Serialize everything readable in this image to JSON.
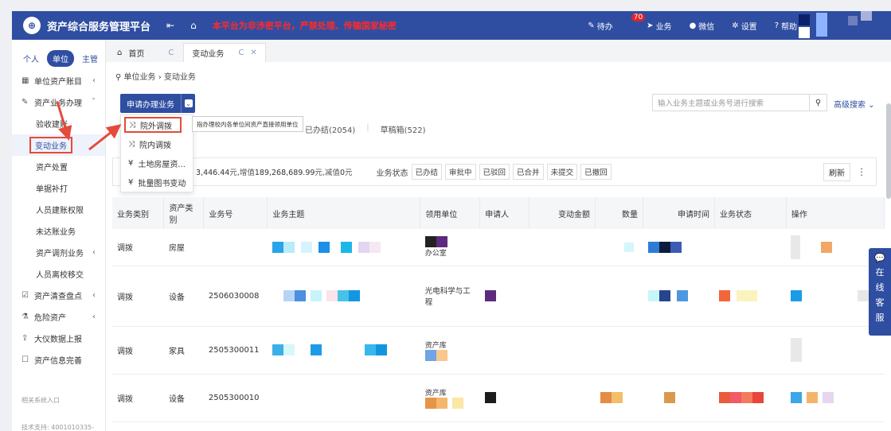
{
  "topbar": {
    "title": "资产综合服务管理平台",
    "notice": "本平台为非涉密平台，严禁处理、传输国家秘密",
    "todo_label": "待办",
    "todo_count": "70",
    "business_label": "业务",
    "wechat_label": "微信",
    "settings_label": "设置",
    "help_label": "帮助"
  },
  "sidebar": {
    "roles": [
      "个人",
      "单位",
      "主管"
    ],
    "items": [
      {
        "label": "单位资产账目",
        "icon": "grid-icon"
      },
      {
        "label": "资产业务办理",
        "icon": "pencil-icon"
      },
      {
        "label": "验收建账"
      },
      {
        "label": "变动业务"
      },
      {
        "label": "资产处置"
      },
      {
        "label": "单据补打"
      },
      {
        "label": "人员建账权限"
      },
      {
        "label": "未达账业务"
      },
      {
        "label": "资产调剂业务"
      },
      {
        "label": "人员离校移交"
      },
      {
        "label": "资产清查盘点",
        "icon": "check-icon"
      },
      {
        "label": "危险资产",
        "icon": "flask-icon"
      },
      {
        "label": "大仪数据上报",
        "icon": "upload-icon"
      },
      {
        "label": "资产信息完善",
        "icon": "edit-icon"
      }
    ],
    "footer1": "相关系统入口",
    "footer2": "技术支持: 4001010335-"
  },
  "tabs": [
    {
      "label": "首页"
    },
    {
      "label": "变动业务"
    }
  ],
  "breadcrumb": "单位业务 › 变动业务",
  "apply_button": "申请办理业务",
  "menu": [
    "院外调拨",
    "院内调拨",
    "土地房屋资...",
    "批量图书变动"
  ],
  "tooltip": "指办理校内各单位间资产直接领用单位",
  "filter_tabs": [
    "已办结(2054)",
    "草稿箱(522)"
  ],
  "search_placeholder": "输入业务主题或业务号进行搜索",
  "advanced_search": "高级搜索",
  "summary": {
    "amount_tail": "3,446.44",
    "unit": "元,",
    "increase_label": "增值",
    "increase": "189,268,689.99",
    "decrease_label": "元,减值",
    "decrease": "0",
    "end_unit": "元"
  },
  "status_label": "业务状态",
  "status_buttons": [
    "已办结",
    "审批中",
    "已驳回",
    "已合并",
    "未提交",
    "已撤回"
  ],
  "refresh": "刷新",
  "table": {
    "headers": [
      "业务类别",
      "资产类别",
      "业务号",
      "业务主题",
      "领用单位",
      "申请人",
      "变动金额",
      "数量",
      "申请时间",
      "业务状态",
      "操作"
    ],
    "rows": [
      {
        "type": "调拨",
        "category": "房屋",
        "no": "",
        "unit": "办公室"
      },
      {
        "type": "调拨",
        "category": "设备",
        "no": "2506030008",
        "unit": "光电科学与工程"
      },
      {
        "type": "调拨",
        "category": "家具",
        "no": "2505300011",
        "unit": "资产库"
      },
      {
        "type": "调拨",
        "category": "设备",
        "no": "2505300010",
        "unit": "资产库"
      }
    ]
  },
  "float_service": [
    "在",
    "线",
    "客",
    "服"
  ],
  "colors": {
    "primary": "#2f4ea1",
    "alert": "#ff2a2a",
    "highlight": "#e54a3b"
  }
}
